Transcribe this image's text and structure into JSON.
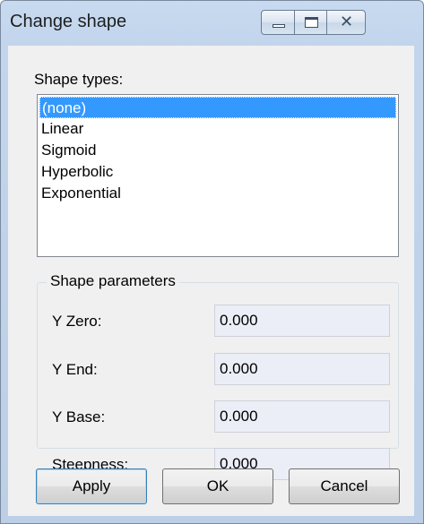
{
  "window": {
    "title": "Change shape",
    "controls": {
      "minimize": "minimize",
      "maximize": "maximize",
      "close": "close"
    }
  },
  "shape_types": {
    "label": "Shape types:",
    "items": [
      "(none)",
      "Linear",
      "Sigmoid",
      "Hyperbolic",
      "Exponential"
    ],
    "selected": "(none)"
  },
  "shape_parameters": {
    "title": "Shape parameters",
    "fields": [
      {
        "label": "Y Zero:",
        "value": "0.000"
      },
      {
        "label": "Y End:",
        "value": "0.000"
      },
      {
        "label": "Y Base:",
        "value": "0.000"
      },
      {
        "label": "Steepness:",
        "value": "0.000"
      }
    ]
  },
  "buttons": {
    "apply": "Apply",
    "ok": "OK",
    "cancel": "Cancel"
  },
  "icons": {
    "minimize": "minimize-icon",
    "maximize": "maximize-icon",
    "close": "close-icon"
  }
}
